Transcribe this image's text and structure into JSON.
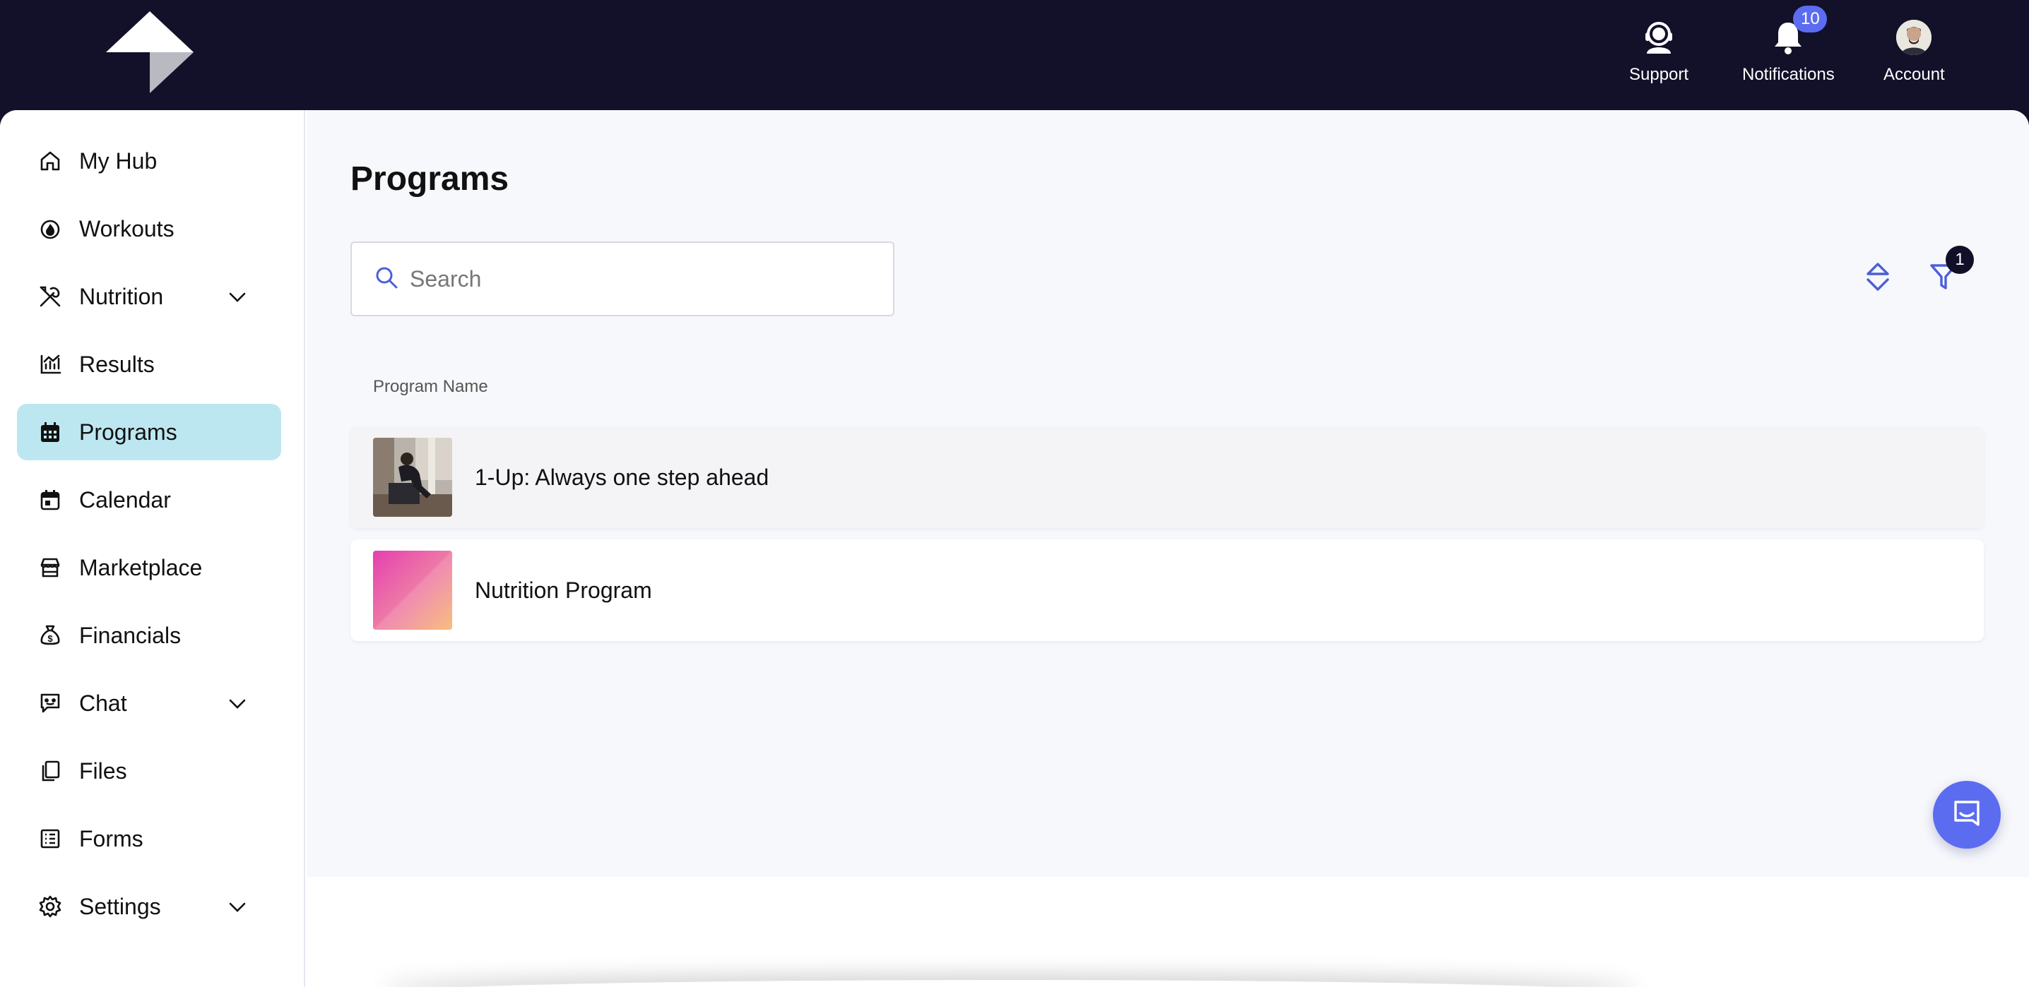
{
  "header": {
    "actions": [
      {
        "label": "Support",
        "icon": "headset-icon"
      },
      {
        "label": "Notifications",
        "icon": "bell-icon",
        "badge": "10"
      },
      {
        "label": "Account",
        "icon": "avatar"
      }
    ]
  },
  "sidebar": {
    "items": [
      {
        "label": "My Hub",
        "icon": "home-icon"
      },
      {
        "label": "Workouts",
        "icon": "flame-icon"
      },
      {
        "label": "Nutrition",
        "icon": "utensils-icon",
        "expandable": true
      },
      {
        "label": "Results",
        "icon": "chart-icon"
      },
      {
        "label": "Programs",
        "icon": "calendar-grid-icon",
        "active": true
      },
      {
        "label": "Calendar",
        "icon": "calendar-icon"
      },
      {
        "label": "Marketplace",
        "icon": "store-icon"
      },
      {
        "label": "Financials",
        "icon": "money-bag-icon"
      },
      {
        "label": "Chat",
        "icon": "chat-icon",
        "expandable": true
      },
      {
        "label": "Files",
        "icon": "files-icon"
      },
      {
        "label": "Forms",
        "icon": "form-icon"
      },
      {
        "label": "Settings",
        "icon": "gear-icon",
        "expandable": true
      }
    ]
  },
  "main": {
    "title": "Programs",
    "search": {
      "placeholder": "Search",
      "value": ""
    },
    "filter_badge": "1",
    "column_header": "Program Name",
    "rows": [
      {
        "name": "1-Up: Always one step ahead",
        "thumb": "photo"
      },
      {
        "name": "Nutrition Program",
        "thumb": "gradient"
      }
    ]
  },
  "colors": {
    "topbar": "#13102a",
    "accent": "#5b6cf0",
    "active_nav": "#bde7f0",
    "background": "#f7f8fc"
  }
}
